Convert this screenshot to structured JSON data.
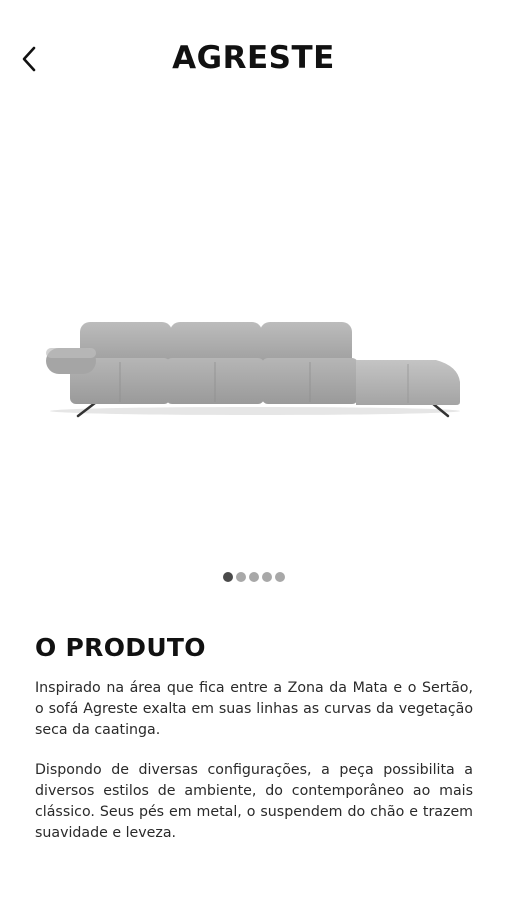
{
  "header": {
    "title": "AGRESTE",
    "back_icon": "chevron-left-icon"
  },
  "gallery": {
    "image_name": "agreste-sofa-image",
    "slide_count": 5,
    "active_index": 0
  },
  "product": {
    "heading": "O PRODUTO",
    "paragraphs": [
      "Inspirado na área que fica entre a Zona da Mata e o Sertão, o sofá Agreste exalta em suas linhas as curvas da vegetação seca da caatinga.",
      "Dispondo de diversas configurações, a peça possibilita a diversos estilos de ambiente, do contemporâneo ao mais clássico. Seus pés em metal, o suspendem do chão e trazem suavidade e leveza."
    ]
  },
  "colors": {
    "dot_active": "#4a4a4a",
    "dot_inactive": "#a8a8a8",
    "sofa_fabric": "#a9a9a9"
  }
}
